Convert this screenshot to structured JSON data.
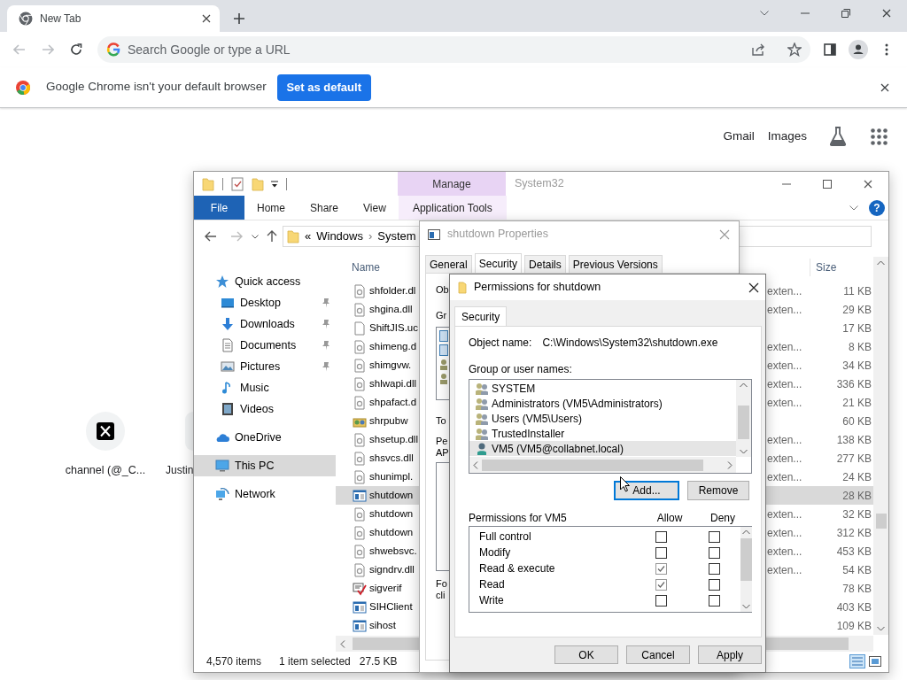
{
  "browser": {
    "tabs": [
      {
        "title": "New Tab",
        "selected": true
      }
    ],
    "omnibox": {
      "placeholder": "Search Google or type a URL"
    },
    "infobar": {
      "message": "Google Chrome isn't your default browser",
      "button": "Set as default"
    }
  },
  "new_tab_page": {
    "links": [
      "Gmail",
      "Images"
    ],
    "shortcuts": [
      {
        "label": "channel (@_C...",
        "kind": "x-logo"
      },
      {
        "label": "Justin",
        "kind": "avatar"
      }
    ]
  },
  "explorer": {
    "contextual_group": "Manage",
    "title": "System32",
    "ribbon_tabs": [
      {
        "label": "File",
        "kind": "file"
      },
      {
        "label": "Home",
        "kind": "plain"
      },
      {
        "label": "Share",
        "kind": "plain"
      },
      {
        "label": "View",
        "kind": "plain"
      },
      {
        "label": "Application Tools",
        "kind": "contextual"
      }
    ],
    "help": "?",
    "address": {
      "overflow": "«",
      "segments": [
        "Windows",
        "System"
      ],
      "separator": "›"
    },
    "navigation": [
      {
        "label": "Quick access",
        "kind": "star",
        "selected": false,
        "children": [
          {
            "label": "Desktop",
            "kind": "desktop",
            "pinned": true,
            "selected": false
          },
          {
            "label": "Downloads",
            "kind": "download",
            "pinned": true,
            "selected": false
          },
          {
            "label": "Documents",
            "kind": "document",
            "pinned": true,
            "selected": false
          },
          {
            "label": "Pictures",
            "kind": "pictures",
            "pinned": true,
            "selected": false
          },
          {
            "label": "Music",
            "kind": "music",
            "pinned": false,
            "selected": false
          },
          {
            "label": "Videos",
            "kind": "videos",
            "pinned": false,
            "selected": false
          }
        ]
      },
      {
        "label": "OneDrive",
        "kind": "cloud",
        "selected": false
      },
      {
        "label": "This PC",
        "kind": "pc",
        "selected": true
      },
      {
        "label": "Network",
        "kind": "network",
        "selected": false
      }
    ],
    "columns": [
      "Name",
      "Size"
    ],
    "files": [
      {
        "name": "shfolder.dl",
        "kind": "dll",
        "type": "exten...",
        "size": "11 KB",
        "selected": false
      },
      {
        "name": "shgina.dll",
        "kind": "dll",
        "type": "exten...",
        "size": "29 KB",
        "selected": false
      },
      {
        "name": "ShiftJIS.uc",
        "kind": "file",
        "size": "17 KB",
        "selected": false
      },
      {
        "name": "shimeng.d",
        "kind": "dll",
        "type": "exten...",
        "size": "8 KB",
        "selected": false
      },
      {
        "name": "shimgvw.",
        "kind": "dll",
        "type": "exten...",
        "size": "34 KB",
        "selected": false
      },
      {
        "name": "shlwapi.dll",
        "kind": "dll",
        "type": "exten...",
        "size": "336 KB",
        "selected": false
      },
      {
        "name": "shpafact.d",
        "kind": "dll",
        "type": "exten...",
        "size": "21 KB",
        "selected": false
      },
      {
        "name": "shrpubw",
        "kind": "setup",
        "size": "60 KB",
        "selected": false
      },
      {
        "name": "shsetup.dll",
        "kind": "dll",
        "type": "exten...",
        "size": "138 KB",
        "selected": false
      },
      {
        "name": "shsvcs.dll",
        "kind": "dll",
        "type": "exten...",
        "size": "277 KB",
        "selected": false
      },
      {
        "name": "shunimpl.",
        "kind": "dll",
        "type": "exten...",
        "size": "24 KB",
        "selected": false
      },
      {
        "name": "shutdown",
        "kind": "app",
        "size": "28 KB",
        "selected": true
      },
      {
        "name": "shutdown",
        "kind": "dll",
        "type": "exten...",
        "size": "32 KB",
        "selected": false
      },
      {
        "name": "shutdown",
        "kind": "dll",
        "type": "exten...",
        "size": "312 KB",
        "selected": false
      },
      {
        "name": "shwebsvc.",
        "kind": "dll",
        "type": "exten...",
        "size": "453 KB",
        "selected": false
      },
      {
        "name": "signdrv.dll",
        "kind": "dll",
        "type": "exten...",
        "size": "54 KB",
        "selected": false
      },
      {
        "name": "sigverif",
        "kind": "verify",
        "size": "78 KB",
        "selected": false
      },
      {
        "name": "SIHClient",
        "kind": "app",
        "size": "403 KB",
        "selected": false
      },
      {
        "name": "sihost",
        "kind": "app",
        "size": "109 KB",
        "selected": false
      }
    ],
    "status": {
      "count": "4,570 items",
      "selection": "1 item selected",
      "size": "27.5 KB"
    }
  },
  "properties_dialog": {
    "title": "shutdown Properties",
    "tabs": [
      {
        "label": "General",
        "selected": false
      },
      {
        "label": "Security",
        "selected": true
      },
      {
        "label": "Details",
        "selected": false
      },
      {
        "label": "Previous Versions",
        "selected": false
      }
    ],
    "cut_labels": [
      "Ob",
      "Gr",
      "To"
    ],
    "cut_paragraphs": [
      [
        "Pe",
        "AP"
      ],
      [
        "Fo",
        "cli"
      ]
    ]
  },
  "permissions_dialog": {
    "title": "Permissions for shutdown",
    "tabs": [
      {
        "label": "Security",
        "selected": true
      }
    ],
    "object_label": "Object name:",
    "object_name": "C:\\Windows\\System32\\shutdown.exe",
    "group_label": "Group or user names:",
    "principals": [
      {
        "name": "SYSTEM",
        "kind": "group",
        "selected": false
      },
      {
        "name": "Administrators (VM5\\Administrators)",
        "kind": "group",
        "selected": false
      },
      {
        "name": "Users (VM5\\Users)",
        "kind": "group",
        "selected": false
      },
      {
        "name": "TrustedInstaller",
        "kind": "group",
        "selected": false
      },
      {
        "name": "VM5 (VM5@collabnet.local)",
        "kind": "user",
        "selected": true
      }
    ],
    "list_buttons": [
      {
        "label": "Add...",
        "focused": true
      },
      {
        "label": "Remove",
        "focused": false
      }
    ],
    "permissions_label": "Permissions for VM5",
    "allow_header": "Allow",
    "deny_header": "Deny",
    "permissions": [
      {
        "name": "Full control",
        "allow": false,
        "deny": false
      },
      {
        "name": "Modify",
        "allow": false,
        "deny": false
      },
      {
        "name": "Read & execute",
        "allow": true,
        "deny": false
      },
      {
        "name": "Read",
        "allow": true,
        "deny": false
      },
      {
        "name": "Write",
        "allow": false,
        "deny": false
      }
    ],
    "buttons": [
      "OK",
      "Cancel",
      "Apply"
    ]
  }
}
